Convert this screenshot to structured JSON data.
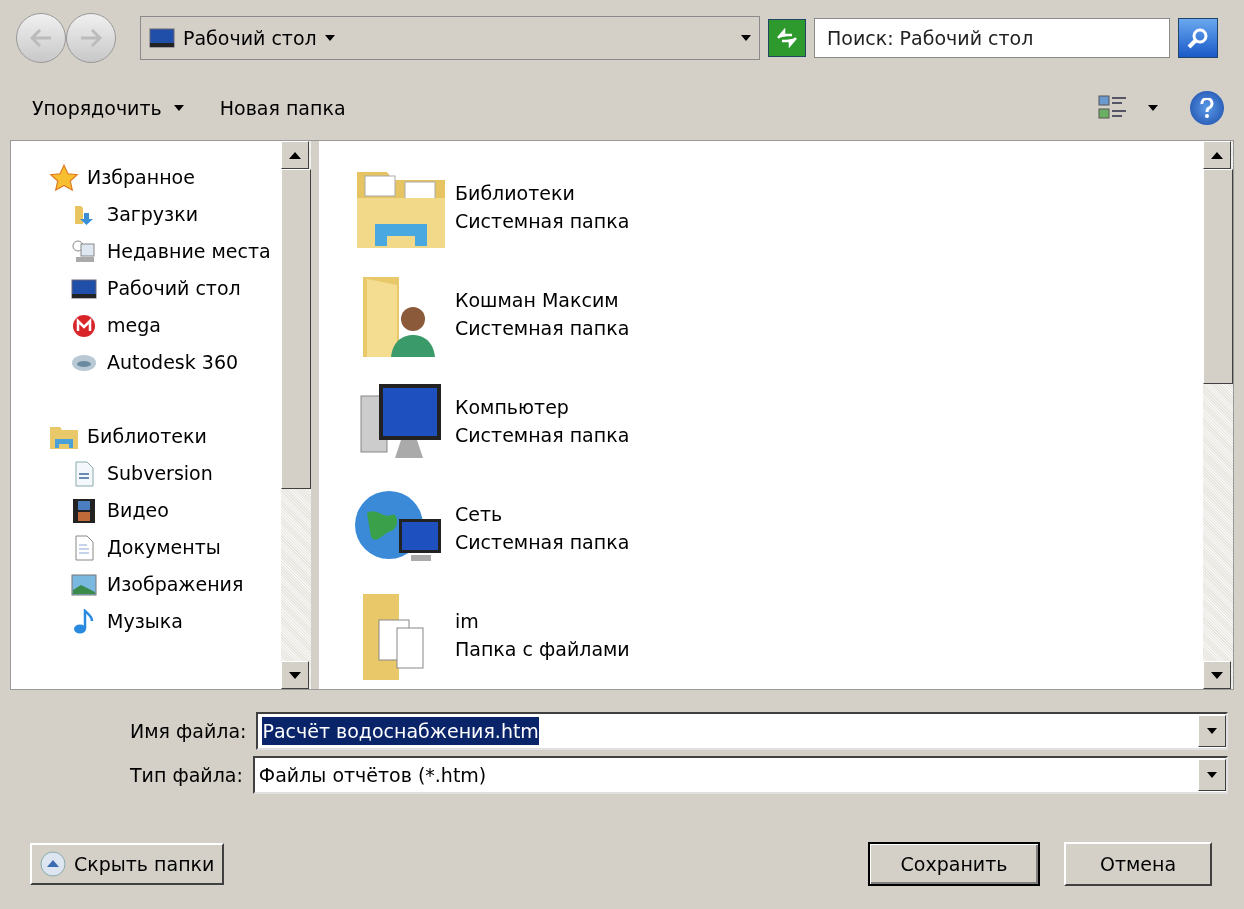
{
  "address_bar": {
    "location": "Рабочий стол",
    "search": {
      "placeholder": "Поиск: Рабочий стол"
    }
  },
  "toolbar": {
    "organize": "Упорядочить",
    "new_folder": "Новая папка"
  },
  "navigation": {
    "groups": [
      {
        "label": "Избранное",
        "children": [
          {
            "label": "Загрузки"
          },
          {
            "label": "Недавние места"
          },
          {
            "label": "Рабочий стол"
          },
          {
            "label": "mega"
          },
          {
            "label": "Autodesk 360"
          }
        ]
      },
      {
        "label": "Библиотеки",
        "children": [
          {
            "label": "Subversion"
          },
          {
            "label": "Видео"
          },
          {
            "label": "Документы"
          },
          {
            "label": "Изображения"
          },
          {
            "label": "Музыка"
          }
        ]
      }
    ]
  },
  "files": [
    {
      "name": "Библиотеки",
      "type": "Системная папка"
    },
    {
      "name": "Кошман Максим",
      "type": "Системная папка"
    },
    {
      "name": "Компьютер",
      "type": "Системная папка"
    },
    {
      "name": "Сеть",
      "type": "Системная папка"
    },
    {
      "name": "im",
      "type": "Папка с файлами"
    }
  ],
  "file_name": {
    "label": "Имя файла:",
    "value": "Расчёт водоснабжения.htm",
    "text_selected": true
  },
  "file_type": {
    "label": "Тип файла:",
    "value": "Файлы отчётов (*.htm)"
  },
  "buttons": {
    "hide_folders": "Скрыть папки",
    "save": "Сохранить",
    "cancel": "Отмена"
  }
}
